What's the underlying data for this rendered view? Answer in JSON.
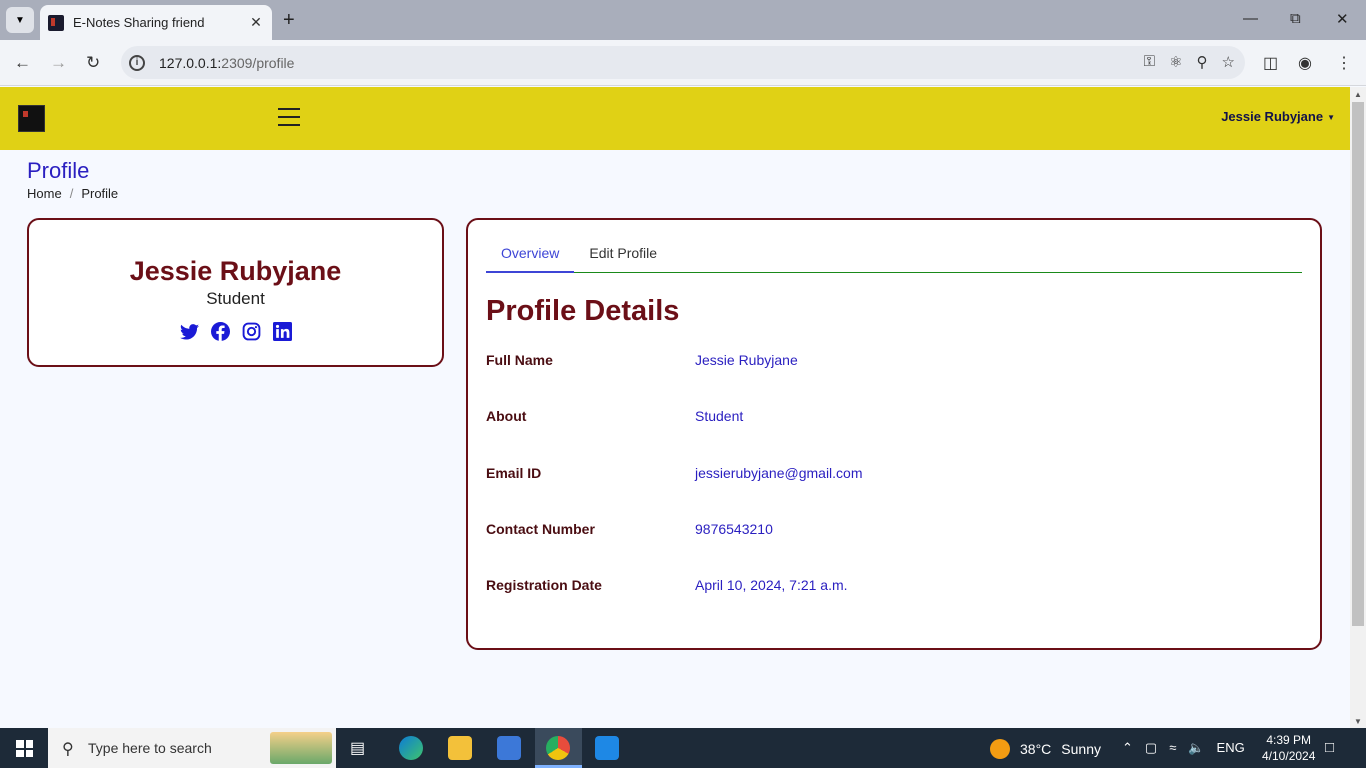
{
  "browser": {
    "tab_title": "E-Notes Sharing friend",
    "url_host": "127.0.0.1:",
    "url_path": "2309/profile"
  },
  "header": {
    "user_name": "Jessie Rubyjane"
  },
  "page": {
    "title": "Profile",
    "breadcrumb": [
      "Home",
      "Profile"
    ]
  },
  "profile_card": {
    "name": "Jessie Rubyjane",
    "role": "Student",
    "social_icons": [
      "twitter-icon",
      "facebook-icon",
      "instagram-icon",
      "linkedin-icon"
    ]
  },
  "tabs": [
    "Overview",
    "Edit Profile"
  ],
  "details": {
    "title": "Profile Details",
    "rows": [
      {
        "label": "Full Name",
        "value": "Jessie Rubyjane"
      },
      {
        "label": "About",
        "value": "Student"
      },
      {
        "label": "Email ID",
        "value": "jessierubyjane@gmail.com"
      },
      {
        "label": "Contact Number",
        "value": "9876543210"
      },
      {
        "label": "Registration Date",
        "value": "April 10, 2024, 7:21 a.m."
      }
    ]
  },
  "taskbar": {
    "search_placeholder": "Type here to search",
    "weather_temp": "38°C",
    "weather_desc": "Sunny",
    "language": "ENG",
    "time": "4:39 PM",
    "date": "4/10/2024"
  },
  "colors": {
    "header": "#e0d115",
    "accent": "#6b0f17",
    "link": "#2a1fc0"
  }
}
